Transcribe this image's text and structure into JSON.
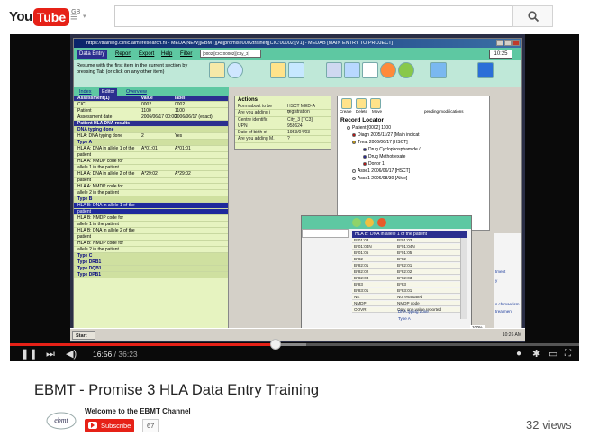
{
  "header": {
    "logo_you": "You",
    "logo_tube": "Tube",
    "region": "GB",
    "guide_icon": "guide-menu-icon",
    "search_placeholder": "",
    "search_icon": "search-icon"
  },
  "video": {
    "title": "EBMT - Promise 3 HLA Data Entry Training",
    "current_time": "16:56",
    "duration": "36:23",
    "progress_fraction": 0.466,
    "buffered_fraction": 0.52,
    "views": "32 views"
  },
  "channel": {
    "name": "Welcome to the EBMT Channel",
    "subscribe_label": "Subscribe",
    "subscriber_count": "67"
  },
  "screen": {
    "window_title": "https://training.clinic.almeresearch.nl - MEDA[NEW][EBMT][All]promise0002trainer][CIC:00002][V1] - MEDAB [MAIN ENTRY TO PROJECT]",
    "menu": [
      "Data Entry",
      "Report",
      "Export",
      "Help",
      "Filter"
    ],
    "filter_value": "[0002][CIC:00002][City_3]",
    "clock": "10:25",
    "tip": "Resume with the first item in the current section by pressing Tab (or click on any other item)",
    "tabs": [
      "Index",
      "Editor",
      "Overview"
    ],
    "grid_head": [
      "Assessment(1)",
      "value",
      "label"
    ],
    "grid_rows": [
      {
        "a": "CIC",
        "b": "0002",
        "c": "0002",
        "type": "row"
      },
      {
        "a": "Patient",
        "b": "1100",
        "c": "1100",
        "type": "row"
      },
      {
        "a": "Assessment date",
        "b": "2006/06/17 00:00",
        "c": "2006/06/17 (exact)",
        "type": "row"
      },
      {
        "a": "Patient HLA DNA results",
        "b": "",
        "c": "",
        "type": "head"
      },
      {
        "a": "DNA typing done",
        "b": "",
        "c": "",
        "type": "section"
      },
      {
        "a": "HLA: DNA typing done",
        "b": "2",
        "c": "Yes",
        "type": "row"
      },
      {
        "a": "Type A",
        "b": "",
        "c": "",
        "type": "section"
      },
      {
        "a": "HLA A: DNA in allele 1 of the",
        "b": "A*01:01",
        "c": "A*01:01",
        "type": "row"
      },
      {
        "a": "patient",
        "b": "",
        "c": "",
        "type": "row"
      },
      {
        "a": "HLA A: NMDP code for",
        "b": "",
        "c": "",
        "type": "row"
      },
      {
        "a": "allele 1 in the patient",
        "b": "",
        "c": "",
        "type": "row"
      },
      {
        "a": "HLA A: DNA in allele 2 of the",
        "b": "A*29:02",
        "c": "A*29:02",
        "type": "row"
      },
      {
        "a": "patient",
        "b": "",
        "c": "",
        "type": "row"
      },
      {
        "a": "HLA A: NMDP code for",
        "b": "",
        "c": "",
        "type": "row"
      },
      {
        "a": "allele 2 in the patient",
        "b": "",
        "c": "",
        "type": "row"
      },
      {
        "a": "Type B",
        "b": "",
        "c": "",
        "type": "section"
      },
      {
        "a": "HLA B: DNA in allele 1 of the",
        "b": "",
        "c": "",
        "type": "sel"
      },
      {
        "a": "patient",
        "b": "",
        "c": "",
        "type": "sel"
      },
      {
        "a": "HLA B: NMDP code for",
        "b": "",
        "c": "",
        "type": "row"
      },
      {
        "a": "allele 1 in the patient",
        "b": "",
        "c": "",
        "type": "row"
      },
      {
        "a": "HLA B: DNA in allele 2 of the",
        "b": "",
        "c": "",
        "type": "row"
      },
      {
        "a": "patient",
        "b": "",
        "c": "",
        "type": "row"
      },
      {
        "a": "HLA B: NMDP code for",
        "b": "",
        "c": "",
        "type": "row"
      },
      {
        "a": "allele 2 in the patient",
        "b": "",
        "c": "",
        "type": "row"
      },
      {
        "a": "Type C",
        "b": "",
        "c": "",
        "type": "section"
      },
      {
        "a": "Type DRB1",
        "b": "",
        "c": "",
        "type": "section"
      },
      {
        "a": "Type DQB1",
        "b": "",
        "c": "",
        "type": "section"
      },
      {
        "a": "Type DPB1",
        "b": "",
        "c": "",
        "type": "section"
      }
    ],
    "actions_title": "Actions",
    "actions": [
      {
        "k": "Form about to be",
        "v": "HSCT MED-A registration"
      },
      {
        "k": "Are you adding i",
        "v": "?"
      },
      {
        "k": "Centre identific",
        "v": "City_3 [TC3]"
      },
      {
        "k": "UPN",
        "v": "958624"
      },
      {
        "k": "Date of birth of",
        "v": "1953/04/03"
      },
      {
        "k": "Are you adding M.",
        "v": "?"
      }
    ],
    "locator_labels": [
      "Create",
      "Delete",
      "Move",
      "pending modifications"
    ],
    "locator_title": "Record Locator",
    "tree": [
      {
        "t": "Patient [0002] 1100",
        "c": "#ffffff"
      },
      {
        "t": "Diagn 2005/11/27 [Main indicat",
        "c": "#cc0000"
      },
      {
        "t": "Treat 2006/06/17 [HSCT]",
        "c": "#d4a000"
      },
      {
        "t": "Drug Cyclophosphamide /",
        "c": "#1a1aa0"
      },
      {
        "t": "Drug Methotrexate",
        "c": "#1a1aa0"
      },
      {
        "t": "Donor 1",
        "c": "#cc0000"
      },
      {
        "t": "Asse1 2006/06/17 [HSCT]",
        "c": "#ffffff"
      },
      {
        "t": "Asse1 2006/08/30 [Alive]",
        "c": "#ffffff"
      }
    ],
    "popup_title": "HLA B: DNA in allele 1 of the patient",
    "popup_rows": [
      {
        "a": "B*01:03",
        "b": "B*01:03"
      },
      {
        "a": "B*01:04N",
        "b": "B*01:04N"
      },
      {
        "a": "B*01:05",
        "b": "B*01:05"
      },
      {
        "a": "B*82",
        "b": "B*82"
      },
      {
        "a": "B*82:01",
        "b": "B*82:01"
      },
      {
        "a": "B*82:02",
        "b": "B*82:02"
      },
      {
        "a": "B*82:03",
        "b": "B*82:03"
      },
      {
        "a": "B*83",
        "b": "B*83"
      },
      {
        "a": "B*83:01",
        "b": "B*83:01"
      },
      {
        "a": "NE",
        "b": "Not evaluated"
      },
      {
        "a": "NMDP",
        "b": "NMDP code"
      },
      {
        "a": "OOVR",
        "b": "Only one value reported"
      }
    ],
    "right_panel": [
      "tment",
      "y",
      "s chimaerism",
      "treatment"
    ],
    "below_popup": [
      "DNA typing done",
      "Type A"
    ],
    "zoom": "100%",
    "start_label": "Start",
    "tray_time": "10:26 AM"
  },
  "controls": {
    "play_icon": "pause-icon",
    "next_icon": "next-icon",
    "volume_icon": "volume-icon",
    "cc_icon": "info-icon",
    "settings_icon": "gear-icon",
    "size_icon": "theater-mode-icon",
    "fullscreen_icon": "fullscreen-icon"
  },
  "colors": {
    "youtube_red": "#e62117",
    "app_green": "#5ec8a2",
    "app_navy": "#2b2f8f",
    "grid_bg": "#e6f3c0"
  }
}
